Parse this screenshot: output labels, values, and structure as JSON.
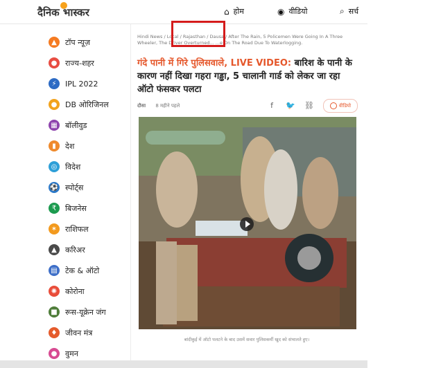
{
  "header": {
    "logo": "दैनिक भास्कर",
    "nav": {
      "home": "होम",
      "video": "वीडियो",
      "search": "सर्च"
    }
  },
  "sidebar": {
    "items": [
      {
        "label": "टॉप न्यूज़",
        "icon": "fire-icon",
        "color": "#f57b22"
      },
      {
        "label": "राज्य-शहर",
        "icon": "location-pin-icon",
        "color": "#e84d43"
      },
      {
        "label": "IPL 2022",
        "icon": "cricket-icon",
        "color": "#2d6bc4"
      },
      {
        "label": "DB ओरिजिनल",
        "icon": "db-original-icon",
        "color": "#f2a31d"
      },
      {
        "label": "बॉलीवुड",
        "icon": "film-icon",
        "color": "#8e44ad"
      },
      {
        "label": "देश",
        "icon": "monument-icon",
        "color": "#ef8a2c"
      },
      {
        "label": "विदेश",
        "icon": "globe-icon",
        "color": "#2e9fd8"
      },
      {
        "label": "स्पोर्ट्स",
        "icon": "sports-icon",
        "color": "#2a78c8"
      },
      {
        "label": "बिजनेस",
        "icon": "business-icon",
        "color": "#1c9b4f"
      },
      {
        "label": "राशिफल",
        "icon": "zodiac-icon",
        "color": "#f39a1e"
      },
      {
        "label": "करिअर",
        "icon": "graduation-cap-icon",
        "color": "#4a4a4a"
      },
      {
        "label": "टेक & ऑटो",
        "icon": "tech-auto-icon",
        "color": "#3e6fc8"
      },
      {
        "label": "कोरोना",
        "icon": "virus-icon",
        "color": "#e94d3a"
      },
      {
        "label": "रूस-यूक्रेन जंग",
        "icon": "tank-icon",
        "color": "#4f7d3a"
      },
      {
        "label": "जीवन मंत्र",
        "icon": "lamp-icon",
        "color": "#e55b2c"
      },
      {
        "label": "वुमन",
        "icon": "woman-icon",
        "color": "#d84b92"
      }
    ]
  },
  "article": {
    "breadcrumb": "Hindi News / Local / Rajasthan / Dausa / After The Rain, 5 Policemen Were Going In A Three Wheeler, The Driver Overturned... ...e On The Road Due To Waterlogging.",
    "headline_accent": "गंदे पानी में गिरे पुलिसवाले, LIVE VIDEO:",
    "headline_rest": " बारिश के पानी के कारण नहीं दिखा गहरा गड्ढा, 5 चालानी गार्ड को लेकर जा रहा ऑटो फंसकर पलटा",
    "meta_place": "दौसा",
    "meta_time": "8 महीने पहले",
    "video_label": "वीडियो",
    "caption": "बांदीकुई में ऑटो पलटने के बाद उसमें सवार पुलिसकर्मी खुद को संभालते हुए।"
  },
  "colors": {
    "accent": "#e5572b",
    "logo_sun": "#f7a21b",
    "highlight_box": "#d41b1b"
  }
}
